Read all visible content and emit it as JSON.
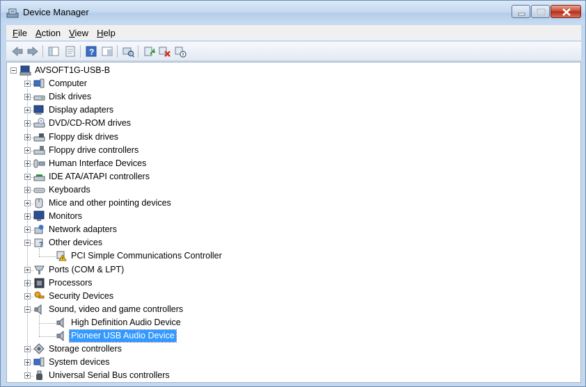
{
  "window": {
    "title": "Device Manager"
  },
  "menu": [
    {
      "label": "File",
      "underline": "F",
      "rest": "ile"
    },
    {
      "label": "Action",
      "underline": "A",
      "rest": "ction"
    },
    {
      "label": "View",
      "underline": "V",
      "rest": "iew"
    },
    {
      "label": "Help",
      "underline": "H",
      "rest": "elp"
    }
  ],
  "toolbar": {
    "buttons": [
      "back-icon",
      "forward-icon",
      "console-tree-icon",
      "properties-icon",
      "help-icon",
      "show-hide-icon",
      "scan-hardware-icon",
      "update-driver-icon",
      "uninstall-icon",
      "disable-icon"
    ]
  },
  "tree": {
    "root": "AVSOFT1G-USB-B",
    "categories": [
      {
        "label": "Computer",
        "icon": "computer-icon",
        "expanded": false
      },
      {
        "label": "Disk drives",
        "icon": "disk-drive-icon",
        "expanded": false
      },
      {
        "label": "Display adapters",
        "icon": "display-adapter-icon",
        "expanded": false
      },
      {
        "label": "DVD/CD-ROM drives",
        "icon": "dvd-drive-icon",
        "expanded": false
      },
      {
        "label": "Floppy disk drives",
        "icon": "floppy-icon",
        "expanded": false
      },
      {
        "label": "Floppy drive controllers",
        "icon": "floppy-controller-icon",
        "expanded": false
      },
      {
        "label": "Human Interface Devices",
        "icon": "hid-icon",
        "expanded": false
      },
      {
        "label": "IDE ATA/ATAPI controllers",
        "icon": "ide-controller-icon",
        "expanded": false
      },
      {
        "label": "Keyboards",
        "icon": "keyboard-icon",
        "expanded": false
      },
      {
        "label": "Mice and other pointing devices",
        "icon": "mouse-icon",
        "expanded": false
      },
      {
        "label": "Monitors",
        "icon": "monitor-icon",
        "expanded": false
      },
      {
        "label": "Network adapters",
        "icon": "network-adapter-icon",
        "expanded": false
      },
      {
        "label": "Other devices",
        "icon": "other-devices-icon",
        "expanded": true,
        "children": [
          {
            "label": "PCI Simple Communications Controller",
            "icon": "warning-device-icon"
          }
        ]
      },
      {
        "label": "Ports (COM & LPT)",
        "icon": "port-icon",
        "expanded": false
      },
      {
        "label": "Processors",
        "icon": "processor-icon",
        "expanded": false
      },
      {
        "label": "Security Devices",
        "icon": "security-device-icon",
        "expanded": false
      },
      {
        "label": "Sound, video and game controllers",
        "icon": "speaker-icon",
        "expanded": true,
        "children": [
          {
            "label": "High Definition Audio Device",
            "icon": "speaker-icon"
          },
          {
            "label": "Pioneer USB Audio Device",
            "icon": "speaker-icon",
            "selected": true
          }
        ]
      },
      {
        "label": "Storage controllers",
        "icon": "storage-controller-icon",
        "expanded": false
      },
      {
        "label": "System devices",
        "icon": "system-device-icon",
        "expanded": false
      },
      {
        "label": "Universal Serial Bus controllers",
        "icon": "usb-icon",
        "expanded": false
      }
    ]
  }
}
